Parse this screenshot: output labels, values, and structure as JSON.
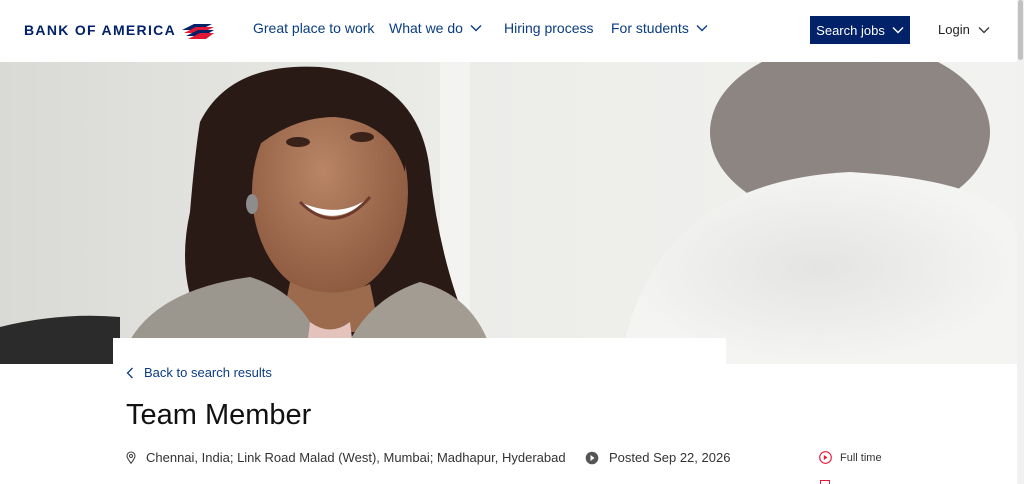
{
  "brand": {
    "name": "BANK OF AMERICA"
  },
  "nav": {
    "items": [
      {
        "label": "Great place to work",
        "has_dropdown": false
      },
      {
        "label": "What we do",
        "has_dropdown": true
      },
      {
        "label": "Hiring process",
        "has_dropdown": false
      },
      {
        "label": "For students",
        "has_dropdown": true
      }
    ],
    "search_label": "Search jobs",
    "login_label": "Login"
  },
  "back_link": {
    "label": "Back to search results"
  },
  "job": {
    "title": "Team Member",
    "locations": "Chennai, India; Link Road Malad (West), Mumbai; Madhapur, Hyderabad",
    "posted": "Posted Sep 22, 2026",
    "type": "Full time"
  },
  "icons": {
    "location": "location-pin-icon",
    "clock": "clock-icon",
    "job_type": "schedule-icon"
  },
  "colors": {
    "brand_navy": "#012169",
    "brand_red": "#E31837",
    "link_blue": "#0A3C83"
  }
}
